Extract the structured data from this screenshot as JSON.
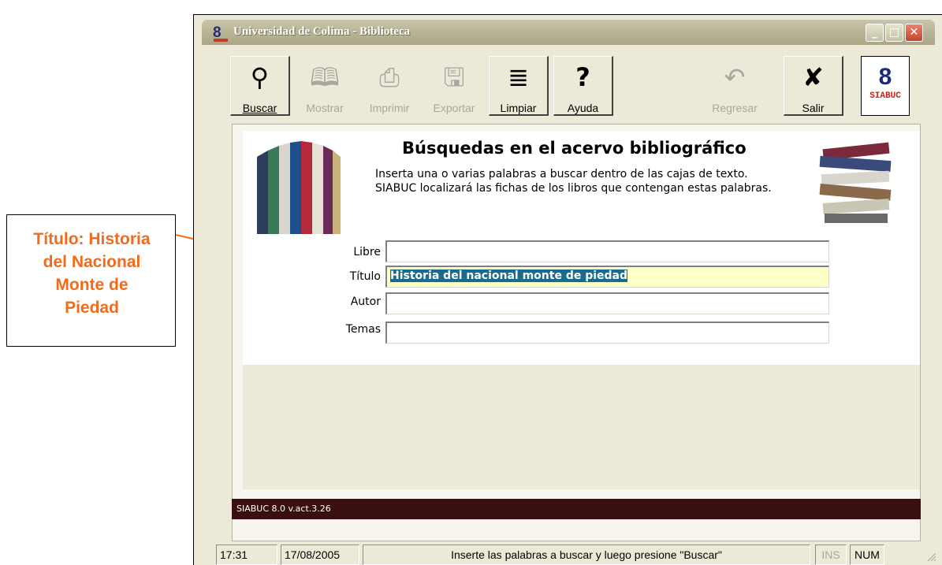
{
  "callout": {
    "text": "Título: Historia\ndel Nacional\nMonte de\nPiedad",
    "color": "#f26a1b"
  },
  "window": {
    "title": "Universidad de Colima - Biblioteca",
    "controls": {
      "minimize": "_",
      "maximize": "□",
      "close": "✕"
    }
  },
  "toolbar": {
    "buttons": [
      {
        "label": "Buscar",
        "icon": "magnifier-icon",
        "glyph": "⚲",
        "enabled": true
      },
      {
        "label": "Mostrar",
        "icon": "books-icon",
        "glyph": "🕮",
        "enabled": false
      },
      {
        "label": "Imprimir",
        "icon": "printer-icon",
        "glyph": "⎙",
        "enabled": false
      },
      {
        "label": "Exportar",
        "icon": "floppy-icon",
        "glyph": "🖫",
        "enabled": false
      },
      {
        "label": "Limpiar",
        "icon": "clear-icon",
        "glyph": "≣",
        "enabled": true
      },
      {
        "label": "Ayuda",
        "icon": "help-icon",
        "glyph": "?",
        "enabled": true
      },
      {
        "label": "Regresar",
        "icon": "back-icon",
        "glyph": "↶",
        "enabled": false
      },
      {
        "label": "Salir",
        "icon": "exit-icon",
        "glyph": "✘",
        "enabled": true
      }
    ],
    "logo": {
      "number": "8",
      "text": "SIABUC"
    }
  },
  "panel": {
    "title": "Búsquedas en el acervo bibliográfico",
    "desc_line1": "Inserta una o varias palabras a buscar dentro de las cajas de texto.",
    "desc_line2": "SIABUC localizará las fichas de los libros que contengan estas palabras.",
    "fields": [
      {
        "label": "Libre",
        "value": ""
      },
      {
        "label": "Título",
        "value": "Historia del nacional monte de piedad"
      },
      {
        "label": "Autor",
        "value": ""
      },
      {
        "label": "Temas",
        "value": ""
      }
    ],
    "footer": "SIABUC 8.0 v.act.3.26"
  },
  "status": {
    "time": "17:31",
    "date": "17/08/2005",
    "message": "Inserte las palabras a buscar y luego presione \"Buscar\"",
    "ins": "INS",
    "num": "NUM"
  },
  "colors": {
    "accent_selection": "#1a6b8c",
    "footer_bg": "#3a0f0f",
    "active_field": "#ffffc8"
  }
}
